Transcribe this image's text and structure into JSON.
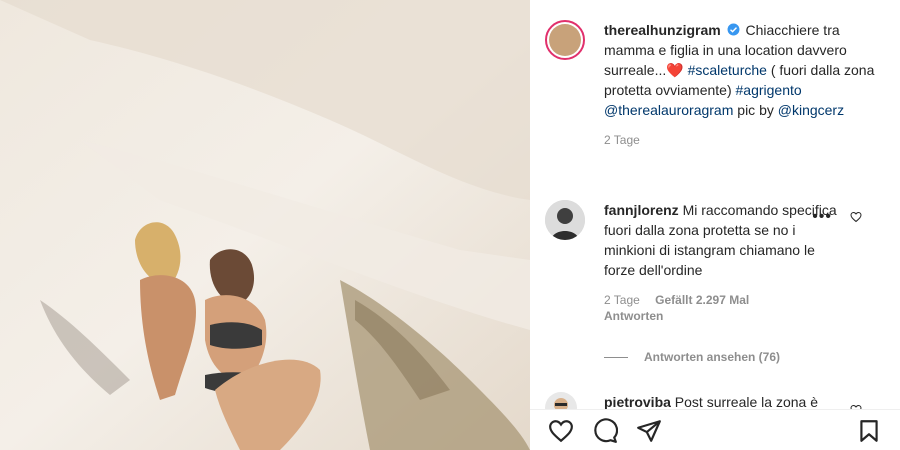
{
  "post": {
    "username": "therealhunzigram",
    "caption_text": "Chiacchiere tra mamma e figlia in una location davvero surreale...",
    "caption_emoji": "❤️",
    "caption_hashtag1": "#scaleturche",
    "caption_rest": "( fuori dalla zona protetta ovviamente)",
    "caption_hashtag2": "#agrigento",
    "caption_mention1": "@therealauroragram",
    "caption_pic_by": "pic by",
    "caption_mention2": "@kingcerz",
    "time": "2 Tage"
  },
  "comments": [
    {
      "username": "fannjlorenz",
      "text": "Mi raccomando specifica fuori dalla zona protetta se no i minkioni di istangram chiamano le forze dell'ordine",
      "time": "2 Tage",
      "likes": "Gefällt 2.297 Mal",
      "reply": "Antworten",
      "view_replies": "Antworten ansehen (76)"
    },
    {
      "username": "pietroviba",
      "text": "Post surreale la zona è"
    }
  ],
  "icons": [
    "verified-icon",
    "heart-icon",
    "more-icon",
    "comment-icon",
    "share-icon",
    "bookmark-icon"
  ],
  "colors": {
    "link": "#00376b",
    "verified": "#3897f0",
    "muted": "#8e8e8e",
    "heart": "#ed4956"
  }
}
